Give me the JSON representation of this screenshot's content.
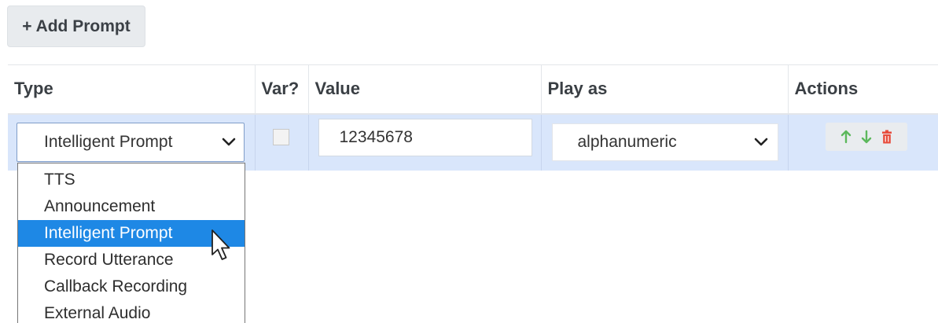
{
  "toolbar": {
    "add_prompt_label": "+ Add Prompt"
  },
  "table": {
    "headers": {
      "type": "Type",
      "var": "Var?",
      "value": "Value",
      "play_as": "Play as",
      "actions": "Actions"
    },
    "row": {
      "type_selected": "Intelligent Prompt",
      "var_checked": false,
      "value": "12345678",
      "play_as_selected": "alphanumeric"
    }
  },
  "type_dropdown": {
    "options": [
      "TTS",
      "Announcement",
      "Intelligent Prompt",
      "Record Utterance",
      "Callback Recording",
      "External Audio"
    ],
    "highlighted": "Intelligent Prompt"
  },
  "colors": {
    "row_highlight": "#d9e6fb",
    "option_highlight": "#1e88e5",
    "up_icon": "#5cb85c",
    "down_icon": "#5cb85c",
    "delete_icon": "#e74c3c"
  },
  "icons": {
    "chevron": "chevron-down-icon",
    "move_up": "arrow-up-icon",
    "move_down": "arrow-down-icon",
    "delete": "trash-icon",
    "cursor": "mouse-pointer-icon"
  }
}
